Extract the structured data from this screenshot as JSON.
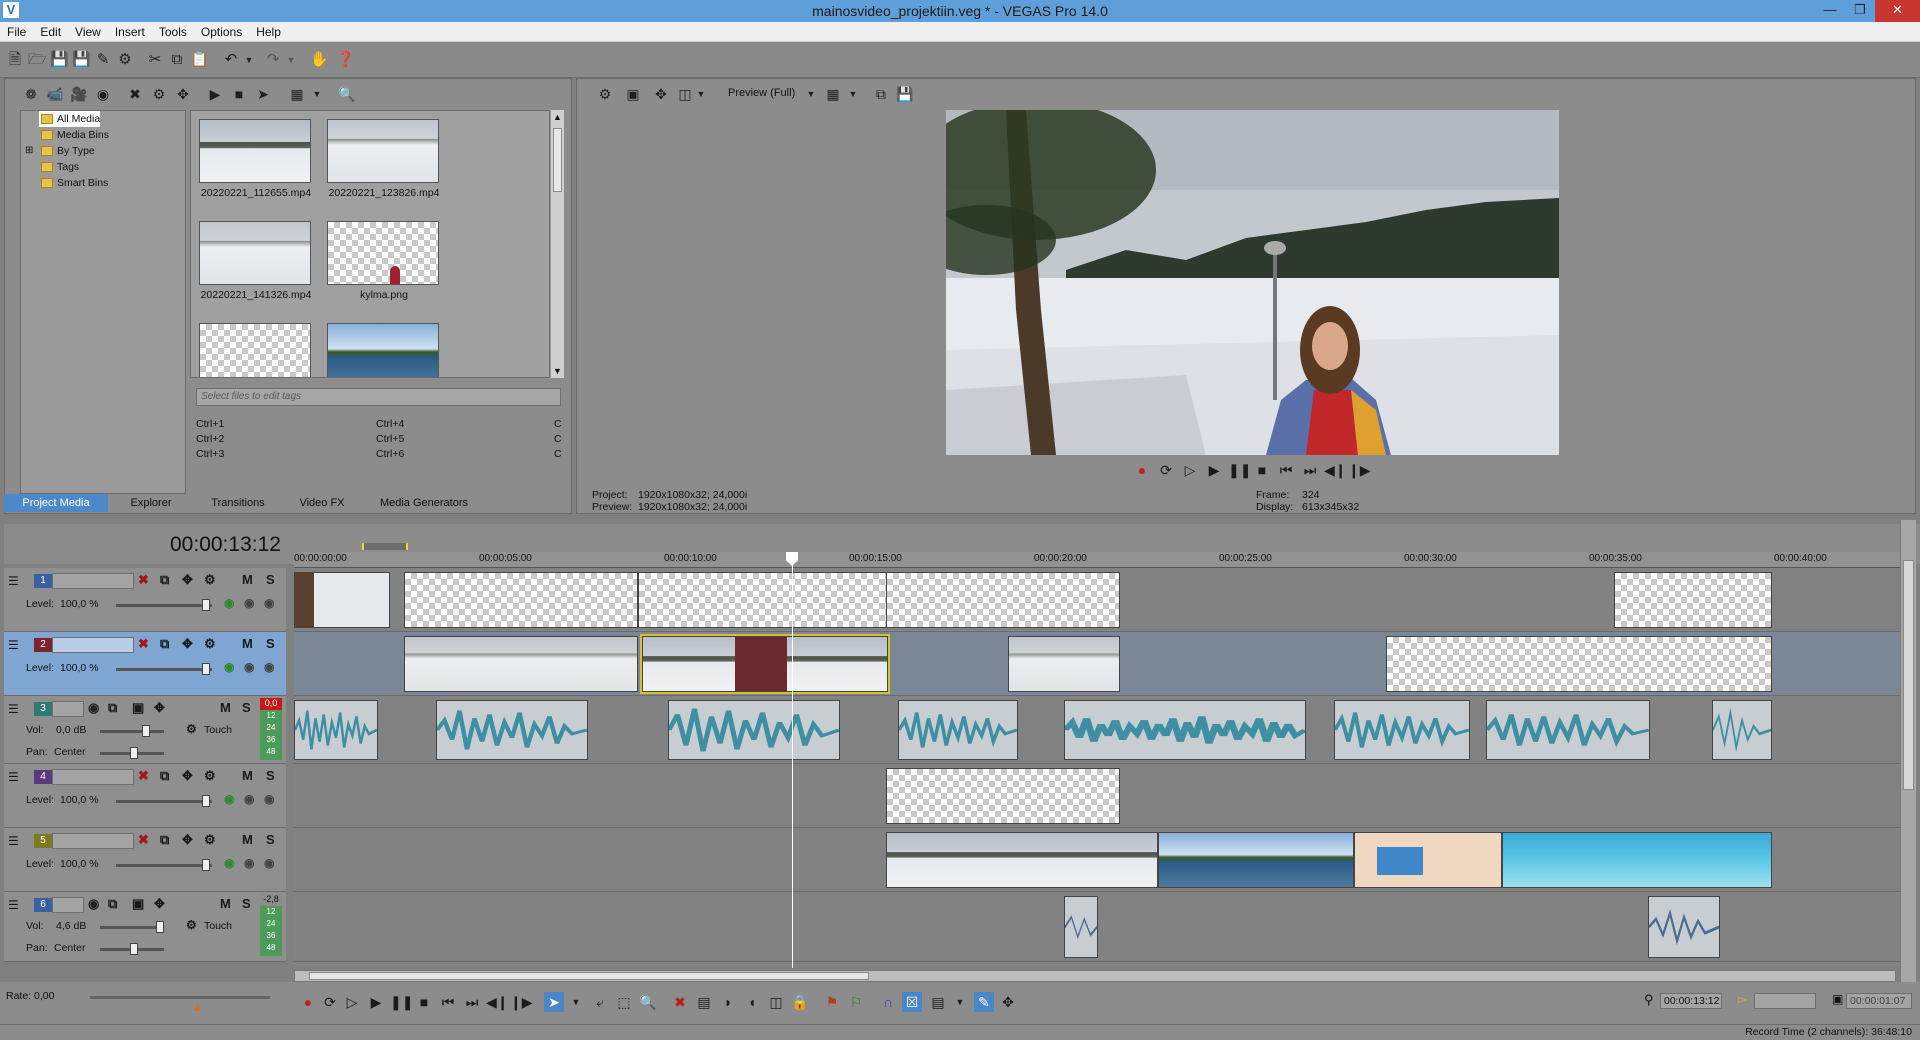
{
  "window": {
    "title": "mainosvideo_projektiin.veg * - VEGAS Pro 14.0",
    "app_icon": "V"
  },
  "menu": [
    "File",
    "Edit",
    "View",
    "Insert",
    "Tools",
    "Options",
    "Help"
  ],
  "media_tree": {
    "items": [
      {
        "label": "All Media",
        "selected": true
      },
      {
        "label": "Media Bins"
      },
      {
        "label": "By Type",
        "expandable": true
      },
      {
        "label": "Tags"
      },
      {
        "label": "Smart Bins"
      }
    ]
  },
  "media_files": [
    {
      "name": "20220221_112655.mp4",
      "kind": "snow"
    },
    {
      "name": "20220221_123826.mp4",
      "kind": "snow2"
    },
    {
      "name": "20220221_141326.mp4",
      "kind": "snow2"
    },
    {
      "name": "kylma.png",
      "kind": "checker"
    },
    {
      "name": "",
      "kind": "checker"
    },
    {
      "name": "",
      "kind": "lake"
    }
  ],
  "tags": {
    "placeholder": "Select files to edit tags"
  },
  "hotkeys": [
    {
      "left": "Ctrl+1",
      "mid": "Ctrl+4",
      "right": "C"
    },
    {
      "left": "Ctrl+2",
      "mid": "Ctrl+5",
      "right": "C"
    },
    {
      "left": "Ctrl+3",
      "mid": "Ctrl+6",
      "right": "C"
    }
  ],
  "tabs": [
    "Project Media",
    "Explorer",
    "Transitions",
    "Video FX",
    "Media Generators"
  ],
  "preview": {
    "mode_label": "Preview (Full)",
    "project_label": "Project:",
    "project_value": "1920x1080x32; 24,000i",
    "preview_label": "Preview:",
    "preview_value": "1920x1080x32; 24,000i",
    "frame_label": "Frame:",
    "frame_value": "324",
    "display_label": "Display:",
    "display_value": "613x345x32"
  },
  "timeline": {
    "timecode": "00:00:13:12",
    "ruler": [
      "00:00:00:00",
      "00:00:05:00",
      "00:00:10:00",
      "00:00:15:00",
      "00:00:20:00",
      "00:00:25:00",
      "00:00:30:00",
      "00:00:35:00",
      "00:00:40:00"
    ]
  },
  "tracks": [
    {
      "num": "1",
      "type": "video",
      "level_label": "Level:",
      "level": "100,0 %",
      "color": "#3a5f9e"
    },
    {
      "num": "2",
      "type": "video",
      "level_label": "Level:",
      "level": "100,0 %",
      "color": "#7a2430",
      "selected": true
    },
    {
      "num": "3",
      "type": "audio",
      "vol_label": "Vol:",
      "vol": "0,0 dB",
      "pan_label": "Pan:",
      "pan": "Center",
      "touch": "Touch",
      "meter": "0,0",
      "color": "#2e7a6f"
    },
    {
      "num": "4",
      "type": "video",
      "level_label": "Level:",
      "level": "100,0 %",
      "color": "#5a3a7e"
    },
    {
      "num": "5",
      "type": "video",
      "level_label": "Level:",
      "level": "100,0 %",
      "color": "#7a7a1e"
    },
    {
      "num": "6",
      "type": "audio",
      "vol_label": "Vol:",
      "vol": "4,6 dB",
      "pan_label": "Pan:",
      "pan": "Center",
      "touch": "Touch",
      "meter": "-2,8",
      "color": "#3a5f9e"
    }
  ],
  "meter_scale": [
    "12",
    "24",
    "36",
    "48"
  ],
  "rate": "Rate: 0,00",
  "status": {
    "cursor_time": "00:00:13:12",
    "end_time": "00:00:01:07",
    "record_time": "Record Time (2 channels): 36:48:10"
  }
}
